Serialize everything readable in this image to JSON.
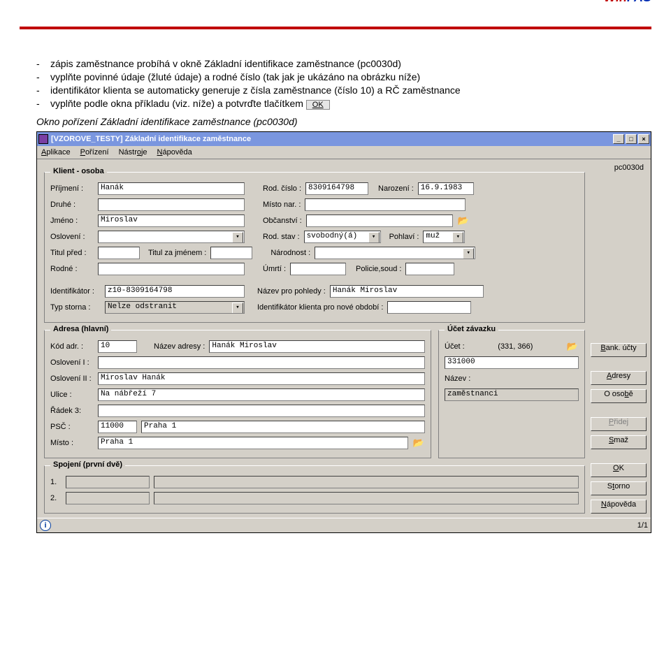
{
  "brand": {
    "part1": "Win",
    "part2": "FAS"
  },
  "doc": {
    "bullets": [
      "zápis zaměstnance probíhá v okně Základní identifikace zaměstnance (pc0030d)",
      "vyplňte povinné údaje (žluté údaje) a rodné číslo (tak jak je ukázáno na obrázku níže)",
      "identifikátor klienta se automaticky generuje z čísla zaměstnance (číslo 10) a RČ zaměstnance",
      "vyplňte podle okna příkladu (viz. níže) a potvrďte tlačítkem"
    ],
    "ok_button_label": "OK",
    "caption": "Okno pořízení Základní identifikace zaměstnance  (pc0030d)"
  },
  "window": {
    "title": "[VZOROVE_TESTY] Základní identifikace zaměstnance",
    "app_id": "pc0030d",
    "menus": [
      "Aplikace",
      "Pořízení",
      "Nástroje",
      "Nápověda"
    ],
    "status_page": "1/1"
  },
  "klient": {
    "legend": "Klient - osoba",
    "labels": {
      "prijmeni": "Příjmení :",
      "druhe": "Druhé :",
      "jmeno": "Jméno :",
      "osloveni": "Oslovení :",
      "titul_pred": "Titul před :",
      "titul_za": "Titul za jménem :",
      "rodne": "Rodné :",
      "rod_cislo": "Rod. číslo :",
      "narozeni": "Narození :",
      "misto_nar": "Místo nar. :",
      "obcanstvi": "Občanství :",
      "rod_stav": "Rod. stav :",
      "pohlavi": "Pohlaví :",
      "narodnost": "Národnost :",
      "umrti": "Úmrtí :",
      "policie": "Policie,soud :",
      "identifikator": "Identifikátor :",
      "nazev_pohledy": "Název pro pohledy :",
      "typ_storna": "Typ storna :",
      "ident_nove": "Identifikátor klienta pro nové období :"
    },
    "values": {
      "prijmeni": "Hanák",
      "druhe": "",
      "jmeno": "Miroslav",
      "osloveni": "",
      "titul_pred": "",
      "titul_za": "",
      "rodne": "",
      "rod_cislo": "8309164798",
      "narozeni": "16.9.1983",
      "misto_nar": "",
      "obcanstvi": "",
      "rod_stav": "svobodný(á)",
      "pohlavi": "muž",
      "narodnost": "",
      "umrti": "",
      "policie": "",
      "identifikator": "z10-8309164798",
      "nazev_pohledy": "Hanák Miroslav",
      "typ_storna": "Nelze odstranit",
      "ident_nove": ""
    }
  },
  "adresa": {
    "legend": "Adresa (hlavní)",
    "labels": {
      "kod": "Kód adr. :",
      "nazev": "Název adresy :",
      "osloveni1": "Oslovení I :",
      "osloveni2": "Oslovení II :",
      "ulice": "Ulice :",
      "radek3": "Řádek 3:",
      "psc": "PSČ :",
      "misto": "Místo :"
    },
    "values": {
      "kod": "10",
      "nazev": "Hanák Miroslav",
      "osloveni1": "",
      "osloveni2": "Miroslav Hanák",
      "ulice": "Na nábřeží 7",
      "radek3": "",
      "psc": "11000",
      "psc_mesto": "Praha 1",
      "misto": "Praha 1"
    }
  },
  "ucet": {
    "legend": "Účet závazku",
    "labels": {
      "ucet": "Účet :",
      "hint": "(331, 366)",
      "nazev": "Název :"
    },
    "values": {
      "ucet": "331000",
      "nazev": "zaměstnanci"
    }
  },
  "spojeni": {
    "legend": "Spojení (první dvě)",
    "labels": {
      "r1": "1.",
      "r2": "2."
    },
    "values": {
      "r1a": "",
      "r1b": "",
      "r2a": "",
      "r2b": ""
    }
  },
  "buttons": {
    "bank_ucty": "Bank. účty",
    "adresy": "Adresy",
    "o_osobe": "O osobě",
    "pridej": "Přidej",
    "smaz": "Smaž",
    "ok": "OK",
    "storno": "Storno",
    "napoveda": "Nápověda"
  }
}
